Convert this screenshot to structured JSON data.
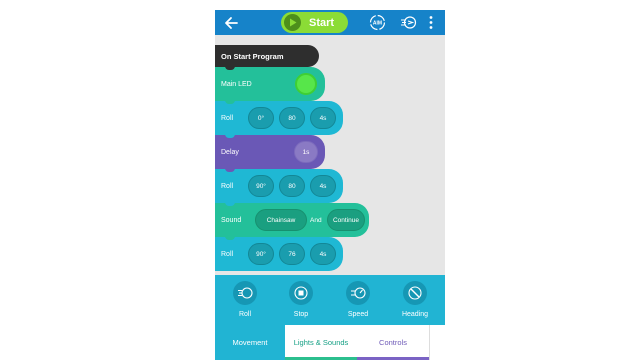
{
  "topbar": {
    "back_icon": "arrow-left-icon",
    "start_label": "Start",
    "aim_label": "AIM",
    "drive_icon": "drive-icon",
    "more_icon": "more-vertical-icon"
  },
  "program": {
    "on_start_label": "On Start Program",
    "main_led": {
      "label": "Main LED",
      "color": "#57e64a"
    },
    "roll1": {
      "label": "Roll",
      "heading": "0°",
      "speed": "80",
      "duration": "4s"
    },
    "delay": {
      "label": "Delay",
      "duration": "1s"
    },
    "roll2": {
      "label": "Roll",
      "heading": "90°",
      "speed": "80",
      "duration": "4s"
    },
    "sound": {
      "label": "Sound",
      "sound": "Chainsaw",
      "and_label": "And",
      "mode": "Continue"
    },
    "roll3": {
      "label": "Roll",
      "heading": "90°",
      "speed": "76",
      "duration": "4s"
    }
  },
  "actions": [
    {
      "label": "Roll",
      "icon": "roll-icon"
    },
    {
      "label": "Stop",
      "icon": "stop-icon"
    },
    {
      "label": "Speed",
      "icon": "speed-icon"
    },
    {
      "label": "Heading",
      "icon": "heading-icon"
    }
  ],
  "tabs": {
    "movement": "Movement",
    "lights_sounds": "Lights & Sounds",
    "controls": "Controls"
  },
  "colors": {
    "topbar": "#1683c9",
    "start": "#8bdc36",
    "movement_block": "#1fb8d4",
    "lights_block": "#23c09a",
    "controls_block": "#6a58b6",
    "event_block": "#2e2e2e"
  }
}
